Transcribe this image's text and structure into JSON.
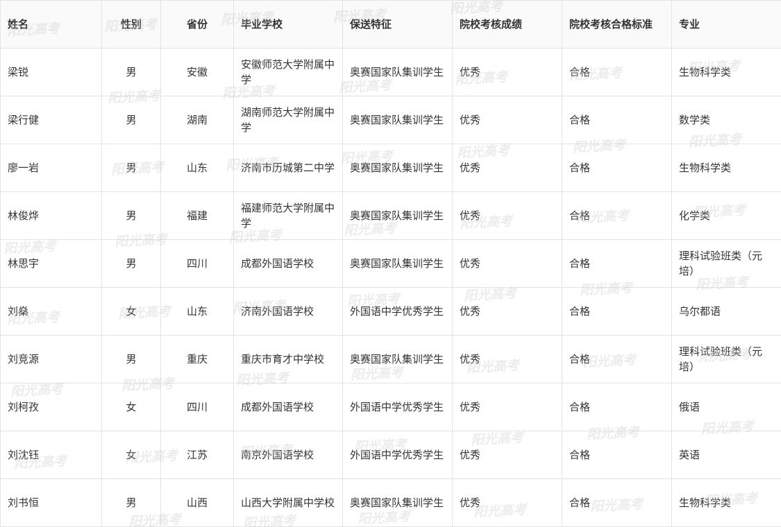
{
  "watermark_text": "阳光高考",
  "columns": [
    "姓名",
    "性别",
    "省份",
    "毕业学校",
    "保送特征",
    "院校考核成绩",
    "院校考核合格标准",
    "专业"
  ],
  "rows": [
    {
      "name": "梁锐",
      "gender": "男",
      "province": "安徽",
      "school": "安徽师范大学附属中学",
      "feature": "奥赛国家队集训学生",
      "score": "优秀",
      "standard": "合格",
      "major": "生物科学类"
    },
    {
      "name": "梁行健",
      "gender": "男",
      "province": "湖南",
      "school": "湖南师范大学附属中学",
      "feature": "奥赛国家队集训学生",
      "score": "优秀",
      "standard": "合格",
      "major": "数学类"
    },
    {
      "name": "廖一岩",
      "gender": "男",
      "province": "山东",
      "school": "济南市历城第二中学",
      "feature": "奥赛国家队集训学生",
      "score": "优秀",
      "standard": "合格",
      "major": "生物科学类"
    },
    {
      "name": "林俊烨",
      "gender": "男",
      "province": "福建",
      "school": "福建师范大学附属中学",
      "feature": "奥赛国家队集训学生",
      "score": "优秀",
      "standard": "合格",
      "major": "化学类"
    },
    {
      "name": "林思宇",
      "gender": "男",
      "province": "四川",
      "school": "成都外国语学校",
      "feature": "奥赛国家队集训学生",
      "score": "优秀",
      "standard": "合格",
      "major": "理科试验班类（元培）"
    },
    {
      "name": "刘燊",
      "gender": "女",
      "province": "山东",
      "school": "济南外国语学校",
      "feature": "外国语中学优秀学生",
      "score": "优秀",
      "standard": "合格",
      "major": "乌尔都语"
    },
    {
      "name": "刘竞源",
      "gender": "男",
      "province": "重庆",
      "school": "重庆市育才中学校",
      "feature": "奥赛国家队集训学生",
      "score": "优秀",
      "standard": "合格",
      "major": "理科试验班类（元培）"
    },
    {
      "name": "刘柯孜",
      "gender": "女",
      "province": "四川",
      "school": "成都外国语学校",
      "feature": "外国语中学优秀学生",
      "score": "优秀",
      "standard": "合格",
      "major": "俄语"
    },
    {
      "name": "刘沈钰",
      "gender": "女",
      "province": "江苏",
      "school": "南京外国语学校",
      "feature": "外国语中学优秀学生",
      "score": "优秀",
      "standard": "合格",
      "major": "英语"
    },
    {
      "name": "刘书恒",
      "gender": "男",
      "province": "山西",
      "school": "山西大学附属中学校",
      "feature": "奥赛国家队集训学生",
      "score": "优秀",
      "standard": "合格",
      "major": "生物科学类"
    }
  ]
}
